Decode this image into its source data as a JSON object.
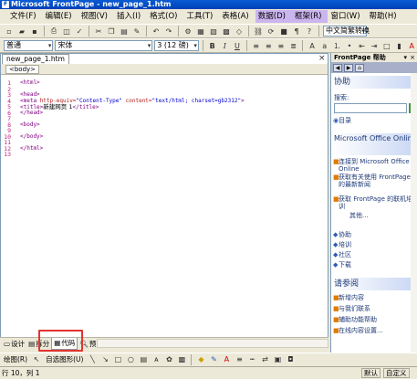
{
  "window": {
    "title": "Microsoft FrontPage - new_page_1.htm"
  },
  "menu": [
    "文件(F)",
    "编辑(E)",
    "视图(V)",
    "插入(I)",
    "格式(O)",
    "工具(T)",
    "表格(A)",
    "数据(D)",
    "框架(R)",
    "窗口(W)",
    "帮助(H)"
  ],
  "toolbar": {
    "style_value": "普通",
    "font_value": "宋体",
    "size_value": "3 (12 磅)",
    "bold_label": "B",
    "italic_label": "I",
    "underline_label": "U",
    "lang_label": "中文简繁转换"
  },
  "editor": {
    "doc_tab": "new_page_1.htm",
    "tag_button": "<body>",
    "line_numbers": [
      "1",
      "2",
      "3",
      "4",
      "5",
      "6",
      "7",
      "8",
      "9",
      "10",
      "11",
      "12",
      "13"
    ],
    "code": [
      {
        "tag": "<html>"
      },
      {
        "tag": ""
      },
      {
        "tag": "<head>"
      },
      {
        "pre": "<meta ",
        "attr": "http-equiv=",
        "val": "\"Content-Type\"",
        "attr2": " content=",
        "val2": "\"text/html; charset=gb2312\"",
        "post": ">"
      },
      {
        "tag": "<title>",
        "text": "新建网页 1",
        "tag2": "</title>"
      },
      {
        "tag": "</head>"
      },
      {
        "tag": ""
      },
      {
        "tag": "<body>"
      },
      {
        "tag": ""
      },
      {
        "tag": "</body>"
      },
      {
        "tag": ""
      },
      {
        "tag": "</html>"
      },
      {
        "tag": ""
      }
    ]
  },
  "view_tabs": {
    "design": "设计",
    "split": "拆分",
    "code": "代码",
    "preview": "预览"
  },
  "draw_toolbar": {
    "draw_label": "绘图(R)",
    "autoshape_label": "自选图形(U)"
  },
  "status": {
    "position": "行 10，列 1",
    "default_label": "默认",
    "custom_label": "自定义"
  },
  "pane": {
    "title": "FrontPage 帮助",
    "help_heading": "协助",
    "search_label": "搜索:",
    "toc_label": "目录",
    "office_heading": "Microsoft Office Online",
    "links": [
      "连接到 Microsoft Office Online",
      "获取有关使用 FrontPage 的最新新闻",
      "获取 FrontPage 的联机培训",
      "其他..."
    ],
    "icon_links": [
      "协助",
      "培训",
      "社区",
      "下载"
    ],
    "see_also_heading": "请参阅",
    "see_also": [
      "新增内容",
      "与我们联系",
      "辅助功能帮助",
      "在线内容设置..."
    ]
  },
  "colors": {
    "title_bar": "#0a5bd3",
    "highlight": "#e3342f",
    "tag_color": "#800080"
  }
}
